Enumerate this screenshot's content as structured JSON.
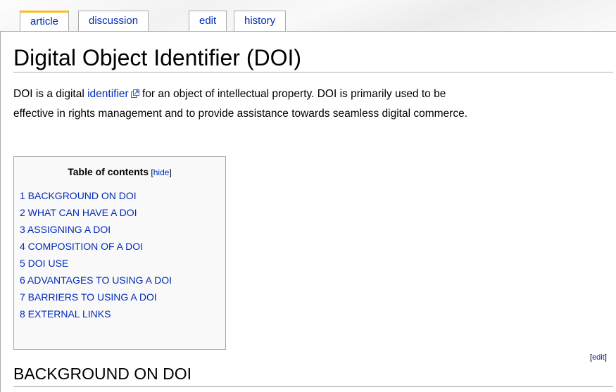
{
  "tabs": {
    "article": "article",
    "discussion": "discussion",
    "edit": "edit",
    "history": "history"
  },
  "article": {
    "title": "Digital Object Identifier (DOI)",
    "intro_before_link": "DOI is a digital ",
    "intro_link": "identifier",
    "intro_line1_after_link": " for an object of intellectual property. DOI is primarily used to be",
    "intro_line2": "effective in rights management and to provide assistance towards seamless digital commerce."
  },
  "toc": {
    "title": "Table of contents",
    "bracket_open": " [",
    "hide_label": "hide",
    "bracket_close": "]",
    "items": [
      "1 BACKGROUND ON DOI",
      "2 WHAT CAN HAVE A DOI",
      "3 ASSIGNING A DOI",
      "4 COMPOSITION OF A DOI",
      "5 DOI USE",
      "6 ADVANTAGES TO USING A DOI",
      "7 BARRIERS TO USING A DOI",
      "8 EXTERNAL LINKS"
    ]
  },
  "section": {
    "title": "BACKGROUND ON DOI",
    "edit_open": "[",
    "edit_label": "edit",
    "edit_close": "]"
  },
  "icons": {
    "external_link": "external-link-icon"
  },
  "colors": {
    "link": "#002bb8",
    "tab_selected_accent": "#fabd23",
    "border": "#aaaaaa",
    "toc_background": "#f9f9f9"
  }
}
